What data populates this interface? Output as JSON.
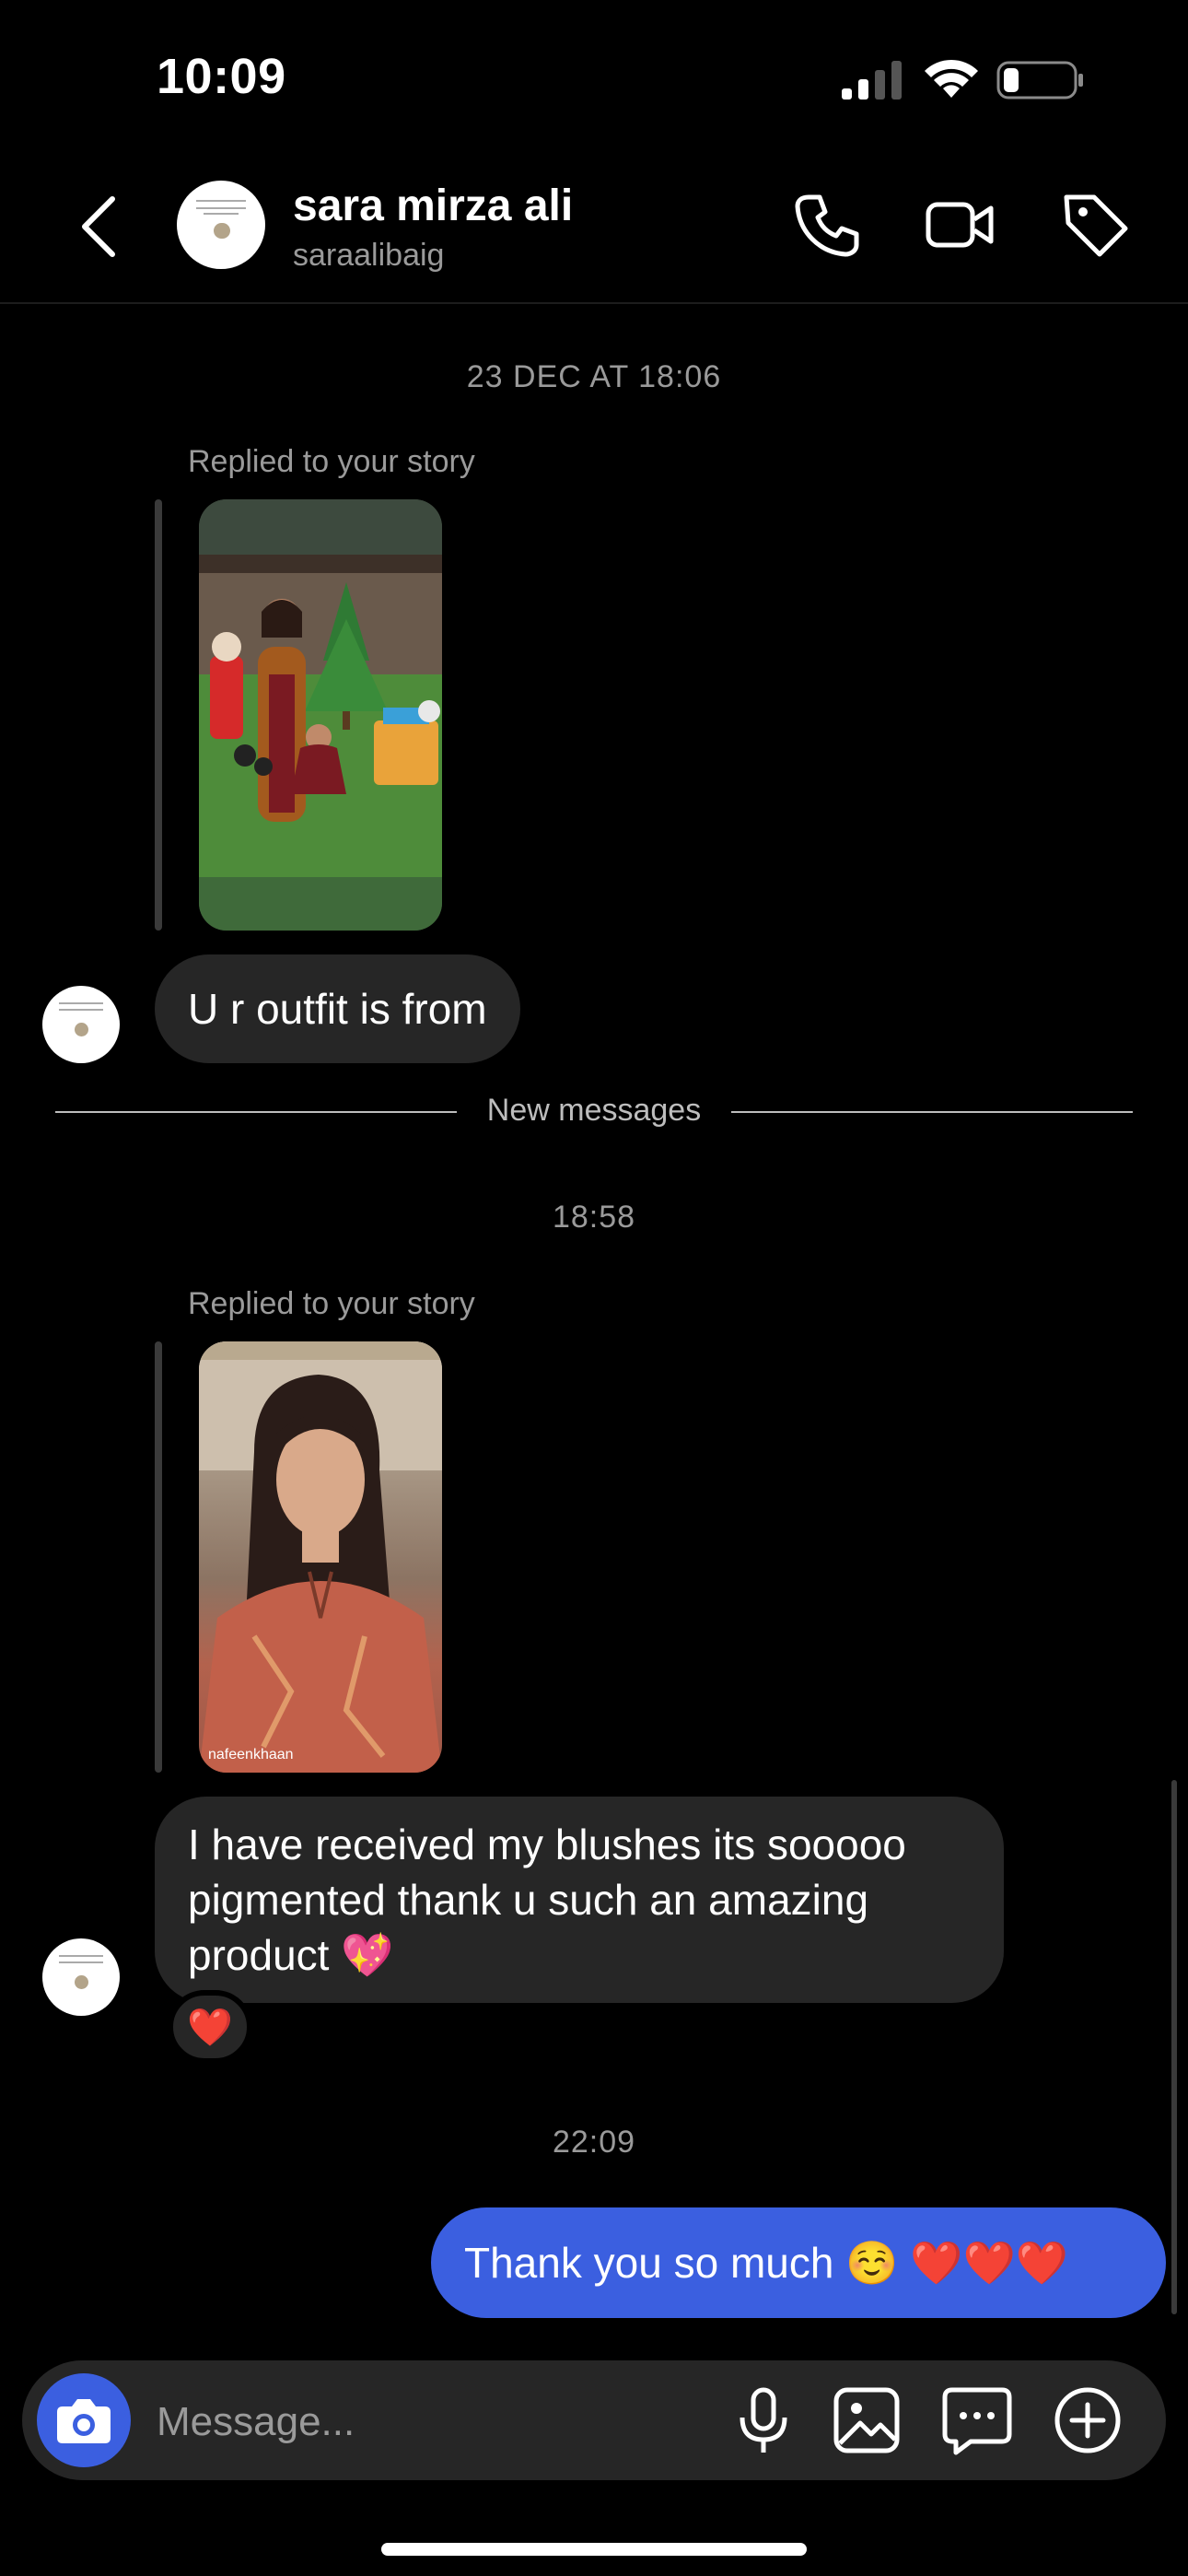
{
  "status_bar": {
    "time": "10:09"
  },
  "header": {
    "name": "sara mirza ali",
    "handle": "saraalibaig",
    "icons": [
      "back-icon",
      "phone-icon",
      "video-camera-icon",
      "tag-icon"
    ]
  },
  "thread": {
    "timestamp_1": "23 DEC AT 18:06",
    "story_reply_1": {
      "label": "Replied to your story"
    },
    "message_1": "U r outfit is from",
    "new_messages_label": "New messages",
    "timestamp_2": "18:58",
    "story_reply_2": {
      "label": "Replied to your story",
      "watermark": "nafeenkhaan"
    },
    "message_2": "I have received my blushes its  sooooo pigmented thank u such an amazing product 💖",
    "reaction": "❤️",
    "timestamp_3": "22:09",
    "message_3": "Thank you so much ☺️ ❤️❤️❤️"
  },
  "composer": {
    "placeholder": "Message...",
    "icons": [
      "camera-icon",
      "microphone-icon",
      "gallery-icon",
      "sticker-icon",
      "plus-icon"
    ]
  },
  "colors": {
    "accent": "#3b5fe0",
    "bubble_in": "#262626",
    "background": "#000000"
  }
}
